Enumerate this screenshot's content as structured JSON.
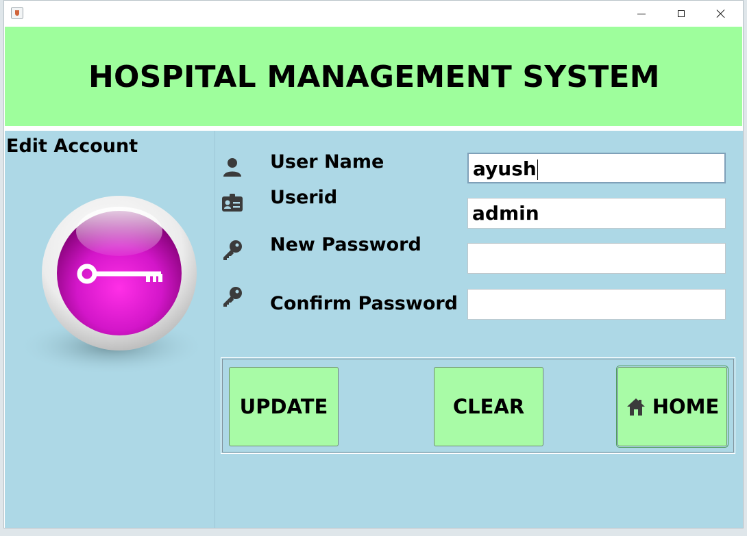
{
  "window": {
    "app_icon": "java-cup-icon",
    "controls": [
      "minimize-icon",
      "maximize-icon",
      "close-icon"
    ]
  },
  "header": {
    "title": "HOSPITAL MANAGEMENT SYSTEM",
    "background": "#9efe9c"
  },
  "sidebar": {
    "title": "Edit Account",
    "image": "key-orb-icon"
  },
  "form": {
    "fields": [
      {
        "label": "User Name",
        "value": "ayush",
        "icon": "user-icon",
        "focused": true
      },
      {
        "label": "Userid",
        "value": "admin",
        "icon": "id-card-icon"
      },
      {
        "label": "New Password",
        "value": "",
        "icon": "key-icon"
      },
      {
        "label": "Confirm Password",
        "value": "",
        "icon": "key-icon"
      }
    ]
  },
  "buttons": {
    "update": "UPDATE",
    "clear": "CLEAR",
    "home": "HOME",
    "home_icon": "home-icon",
    "color": "#a8fba6"
  },
  "panel_color": "#add8e6"
}
